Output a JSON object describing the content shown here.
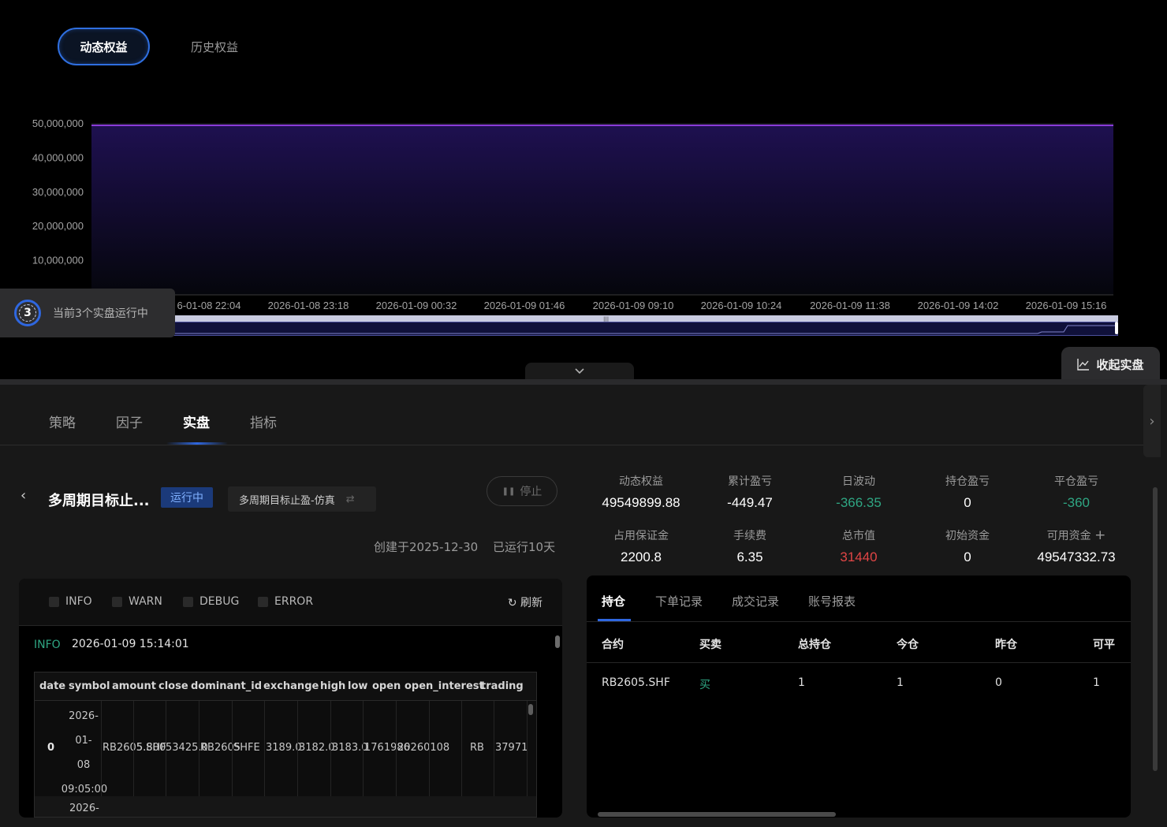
{
  "top_tabs": {
    "active": "动态权益",
    "inactive": "历史权益"
  },
  "chart_data": {
    "type": "area",
    "title": "",
    "xlabel": "",
    "ylabel": "",
    "ylim": [
      0,
      50000000
    ],
    "y_ticks": [
      "10,000,000",
      "20,000,000",
      "30,000,000",
      "40,000,000",
      "50,000,000"
    ],
    "x_ticks": [
      "6-01-08 22:04",
      "2026-01-08 23:18",
      "2026-01-09 00:32",
      "2026-01-09 01:46",
      "2026-01-09 09:10",
      "2026-01-09 10:24",
      "2026-01-09 11:38",
      "2026-01-09 14:02",
      "2026-01-09 15:16"
    ],
    "series": [
      {
        "values": [
          49550000,
          49550000,
          49550000,
          49550000,
          49550000,
          49550000,
          49550000,
          49550000,
          49549900
        ]
      }
    ],
    "grid": true,
    "colors": {
      "line": "#8a3bd8",
      "fill_top": "#1e1050",
      "fill_bottom": "#05060c"
    }
  },
  "running_badge": {
    "count": "3",
    "text": "当前3个实盘运行中"
  },
  "fold_button": "收起实盘",
  "nav_tabs": [
    "策略",
    "因子",
    "实盘",
    "指标"
  ],
  "strategy": {
    "title": "多周期目标止...",
    "status": "运行中",
    "name_chip": "多周期目标止盈-仿真",
    "stop_label": "停止",
    "created": "创建于2025-12-30",
    "running_days": "已运行10天"
  },
  "stats": [
    {
      "label": "动态权益",
      "value": "49549899.88",
      "tone": "normal"
    },
    {
      "label": "累计盈亏",
      "value": "-449.47",
      "tone": "normal"
    },
    {
      "label": "日波动",
      "value": "-366.35",
      "tone": "green"
    },
    {
      "label": "持仓盈亏",
      "value": "0",
      "tone": "normal"
    },
    {
      "label": "平仓盈亏",
      "value": "-360",
      "tone": "green"
    },
    {
      "label": "占用保证金",
      "value": "2200.8",
      "tone": "normal"
    },
    {
      "label": "手续费",
      "value": "6.35",
      "tone": "normal"
    },
    {
      "label": "总市值",
      "value": "31440",
      "tone": "red"
    },
    {
      "label": "初始资金",
      "value": "0",
      "tone": "normal"
    },
    {
      "label": "可用资金",
      "value": "49547332.73",
      "tone": "normal"
    }
  ],
  "log": {
    "filters": [
      "INFO",
      "WARN",
      "DEBUG",
      "ERROR"
    ],
    "refresh": "刷新",
    "entry_level": "INFO",
    "entry_time": "2026-01-09 15:14:01",
    "df_columns": [
      "date",
      "symbol",
      "amount",
      "close",
      "dominant_id",
      "exchange",
      "high",
      "low",
      "open",
      "open_interest",
      "trading"
    ],
    "row_index": "0",
    "row_date": [
      "2026-",
      "01-",
      "08",
      "09:05:00"
    ],
    "row_cells": [
      "RB2605.SHF",
      "5.800",
      "53425.0",
      "RB2605",
      "SHFE",
      "3189.0",
      "3182.0",
      "3183.0",
      "1761986",
      "20260108",
      "RB",
      "37971"
    ],
    "row2_date": "2026-"
  },
  "positions": {
    "tabs": [
      "持仓",
      "下单记录",
      "成交记录",
      "账号报表"
    ],
    "headers": [
      "合约",
      "买卖",
      "总持仓",
      "今仓",
      "昨仓",
      "可平"
    ],
    "rows": [
      [
        "RB2605.SHF",
        "买",
        "1",
        "1",
        "0",
        "1"
      ]
    ]
  }
}
